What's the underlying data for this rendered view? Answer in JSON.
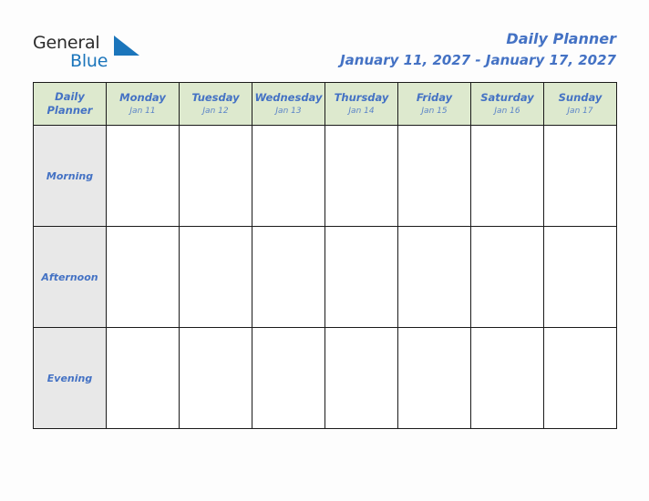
{
  "brand": {
    "name_part1": "General",
    "name_part2": "Blue",
    "triangle_color": "#1b75bb"
  },
  "header": {
    "title": "Daily Planner",
    "date_range": "January 11, 2027 - January 17, 2027"
  },
  "colors": {
    "accent_blue": "#4472c4",
    "header_green": "#dde9ce",
    "row_label_gray": "#e8e8e8",
    "grid_line": "#1a1a1a",
    "page_background": "#fdfdfd",
    "logo_blue": "#1b75bb",
    "logo_dark": "#2b2b2b"
  },
  "table": {
    "corner": {
      "line1": "Daily",
      "line2": "Planner"
    },
    "columns": [
      {
        "day": "Monday",
        "date": "Jan 11"
      },
      {
        "day": "Tuesday",
        "date": "Jan 12"
      },
      {
        "day": "Wednesday",
        "date": "Jan 13"
      },
      {
        "day": "Thursday",
        "date": "Jan 14"
      },
      {
        "day": "Friday",
        "date": "Jan 15"
      },
      {
        "day": "Saturday",
        "date": "Jan 16"
      },
      {
        "day": "Sunday",
        "date": "Jan 17"
      }
    ],
    "rows": [
      {
        "label": "Morning",
        "cells": [
          "",
          "",
          "",
          "",
          "",
          "",
          ""
        ]
      },
      {
        "label": "Afternoon",
        "cells": [
          "",
          "",
          "",
          "",
          "",
          "",
          ""
        ]
      },
      {
        "label": "Evening",
        "cells": [
          "",
          "",
          "",
          "",
          "",
          "",
          ""
        ]
      }
    ]
  }
}
